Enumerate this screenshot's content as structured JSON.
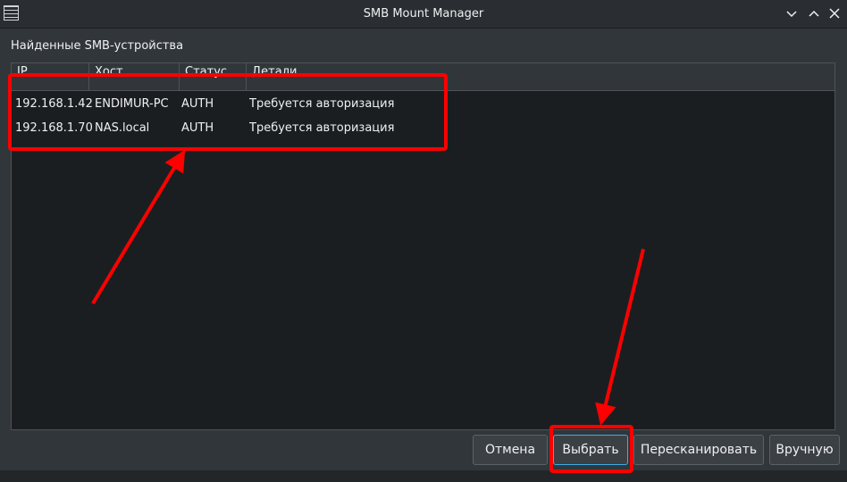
{
  "window": {
    "title": "SMB Mount Manager",
    "icon": "app-menu-icon"
  },
  "section": {
    "label": "Найденные SMB-устройства"
  },
  "table": {
    "columns": [
      "IP",
      "Хост",
      "Статус",
      "Детали"
    ],
    "rows": [
      {
        "ip": "192.168.1.42",
        "host": "ENDIMUR-PC",
        "status": "AUTH",
        "details": "Требуется авторизация"
      },
      {
        "ip": "192.168.1.70",
        "host": "NAS.local",
        "status": "AUTH",
        "details": "Требуется авторизация"
      }
    ]
  },
  "buttons": {
    "cancel": "Отмена",
    "select": "Выбрать",
    "rescan": "Пересканировать",
    "manual": "Вручную"
  },
  "colors": {
    "annotation": "#ff0000",
    "accent": "#3daee9"
  }
}
